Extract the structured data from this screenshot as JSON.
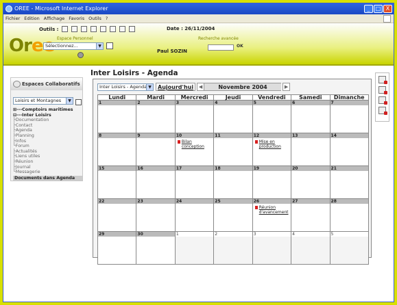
{
  "window": {
    "title": "OREE - Microsoft Internet Explorer",
    "min": "_",
    "max": "□",
    "close": "X"
  },
  "menu": [
    "Fichier",
    "Edition",
    "Affichage",
    "Favoris",
    "Outils",
    "?"
  ],
  "header": {
    "logo_main": "Or",
    "logo_accent": "ee",
    "outils_label": "Outils :",
    "date_label": "Date :  26/11/2004",
    "espace_label": "Espace Personnel",
    "recherche_label": "Recherche avancée",
    "user_select": "Sélectionnez...",
    "user_name": "Paul SOZIN",
    "ok_label": "OK"
  },
  "sidebar": {
    "title": "Espaces Collaboratifs",
    "space_select": "Loisirs et Montagnes",
    "tree": [
      {
        "label": "⊞---Comptoirs maritimes",
        "cls": "b"
      },
      {
        "label": "⊟---Inter Loisirs",
        "cls": "b"
      },
      {
        "label": "   ├Documentation",
        "cls": "g"
      },
      {
        "label": "   ├Contact",
        "cls": "g"
      },
      {
        "label": "   ├Agenda",
        "cls": "g"
      },
      {
        "label": "   ├Planning",
        "cls": "g"
      },
      {
        "label": "   ├Infos",
        "cls": "g"
      },
      {
        "label": "   └Forum",
        "cls": "g"
      },
      {
        "label": "├Actualités",
        "cls": "g"
      },
      {
        "label": "├Liens utiles",
        "cls": "g"
      },
      {
        "label": "├Réunion",
        "cls": "g"
      },
      {
        "label": "├Journal",
        "cls": "g"
      },
      {
        "label": "└Messagerie",
        "cls": "g"
      },
      {
        "label": "Documents dans Agenda",
        "cls": "docs"
      }
    ]
  },
  "page": {
    "title": "Inter Loisirs - Agenda"
  },
  "calendar": {
    "view_select": "Inter Loisirs - Agenda",
    "today_label": "Aujourd'hui",
    "prev": "◀",
    "next": "▶",
    "month": "Novembre 2004",
    "days": [
      "Lundi",
      "Mardi",
      "Mercredi",
      "Jeudi",
      "Vendredi",
      "Samedi",
      "Dimanche"
    ],
    "weeks": [
      [
        {
          "n": "1"
        },
        {
          "n": "2"
        },
        {
          "n": "3"
        },
        {
          "n": "4"
        },
        {
          "n": "5"
        },
        {
          "n": "6"
        },
        {
          "n": "7"
        }
      ],
      [
        {
          "n": "8"
        },
        {
          "n": "9"
        },
        {
          "n": "10",
          "ev": "Bilan conception"
        },
        {
          "n": "11"
        },
        {
          "n": "12",
          "ev": "Mise en production"
        },
        {
          "n": "13"
        },
        {
          "n": "14"
        }
      ],
      [
        {
          "n": "15"
        },
        {
          "n": "16"
        },
        {
          "n": "17"
        },
        {
          "n": "18"
        },
        {
          "n": "19"
        },
        {
          "n": "20"
        },
        {
          "n": "21"
        }
      ],
      [
        {
          "n": "22"
        },
        {
          "n": "23"
        },
        {
          "n": "24"
        },
        {
          "n": "25"
        },
        {
          "n": "26",
          "ev": "Réunion d'avancement"
        },
        {
          "n": "27"
        },
        {
          "n": "28"
        }
      ],
      [
        {
          "n": "29"
        },
        {
          "n": "30"
        },
        {
          "n": "1",
          "o": true
        },
        {
          "n": "2",
          "o": true
        },
        {
          "n": "3",
          "o": true
        },
        {
          "n": "4",
          "o": true
        },
        {
          "n": "5",
          "o": true
        }
      ]
    ]
  }
}
